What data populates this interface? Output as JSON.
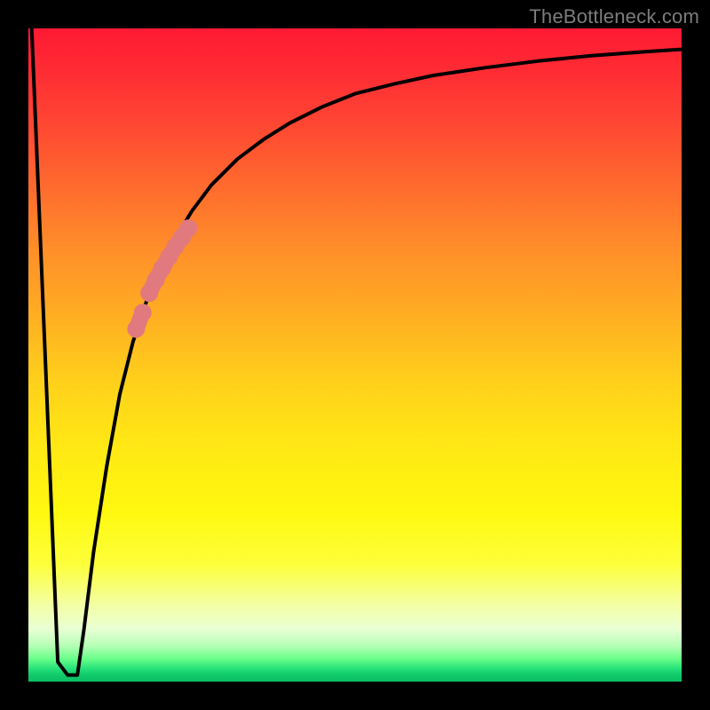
{
  "watermark": "TheBottleneck.com",
  "chart_data": {
    "type": "line",
    "title": "",
    "xlabel": "",
    "ylabel": "",
    "xlim": [
      0,
      100
    ],
    "ylim": [
      0,
      100
    ],
    "grid": false,
    "legend": false,
    "series": [
      {
        "name": "left-descent",
        "color": "#000000",
        "x": [
          0.5,
          4.5,
          6.0
        ],
        "y": [
          100,
          3,
          1
        ]
      },
      {
        "name": "notch-floor",
        "color": "#000000",
        "x": [
          6.0,
          7.5
        ],
        "y": [
          1,
          1
        ]
      },
      {
        "name": "main-curve",
        "color": "#000000",
        "x": [
          7.5,
          8.5,
          10,
          12,
          14,
          16,
          18,
          20,
          22,
          25,
          28,
          32,
          36,
          40,
          45,
          50,
          56,
          62,
          70,
          78,
          86,
          94,
          100
        ],
        "y": [
          1,
          8,
          20,
          33,
          44,
          52,
          58,
          63,
          67,
          72,
          76,
          80,
          83,
          85.5,
          88,
          90,
          91.5,
          92.8,
          94,
          95,
          95.8,
          96.4,
          96.8
        ]
      },
      {
        "name": "highlight-segment-upper",
        "color": "#e07a7e",
        "x": [
          18.5,
          19.5,
          20.5,
          21.5,
          22.5,
          23.5,
          24.5
        ],
        "y": [
          59.5,
          61.5,
          63.3,
          65.0,
          66.6,
          68.0,
          69.4
        ]
      },
      {
        "name": "highlight-segment-lower",
        "color": "#e07a7e",
        "x": [
          16.5,
          17.5
        ],
        "y": [
          54.0,
          56.5
        ]
      }
    ],
    "background_gradient": {
      "orientation": "vertical",
      "stops": [
        {
          "pos": 0.0,
          "color": "#ff1a33"
        },
        {
          "pos": 0.3,
          "color": "#ff8f29"
        },
        {
          "pos": 0.6,
          "color": "#ffe814"
        },
        {
          "pos": 0.9,
          "color": "#f4ffa0"
        },
        {
          "pos": 1.0,
          "color": "#0bbf63"
        }
      ]
    }
  }
}
